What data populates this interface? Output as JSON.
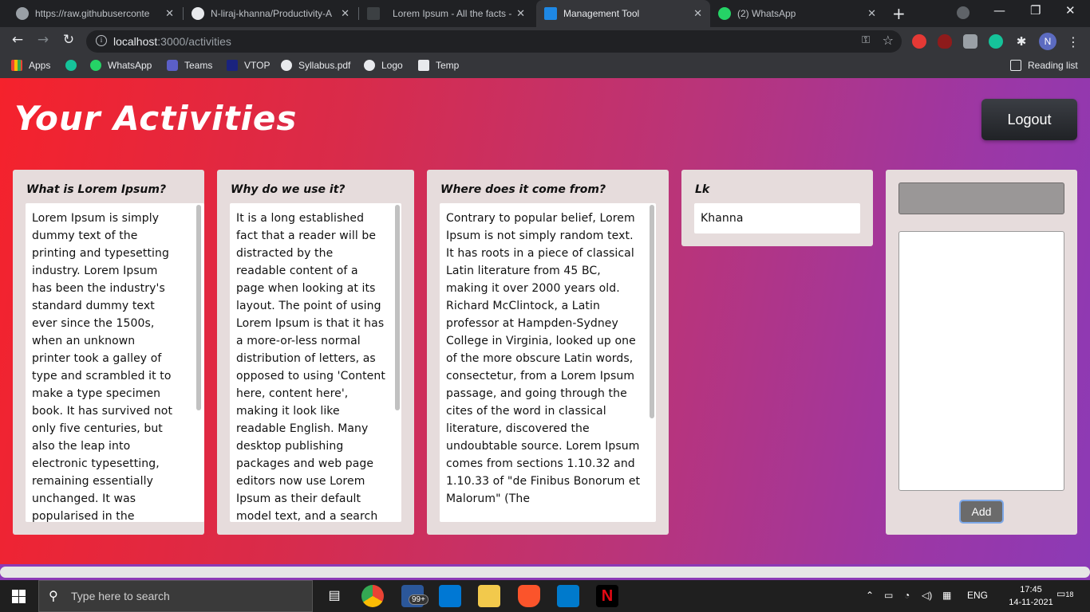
{
  "browser": {
    "tabs": [
      {
        "title": "https://raw.githubuserconte",
        "favicon": "globe-icon"
      },
      {
        "title": "N-liraj-khanna/Productivity-A",
        "favicon": "github-icon"
      },
      {
        "title": "Lorem Ipsum - All the facts - L",
        "favicon": "document-icon"
      },
      {
        "title": "Management Tool",
        "favicon": "management-tool-icon"
      },
      {
        "title": "(2) WhatsApp",
        "favicon": "whatsapp-icon"
      }
    ],
    "active_tab_index": 3,
    "url_host": "localhost",
    "url_rest": ":3000/activities",
    "bookmarks": [
      "Apps",
      "WhatsApp",
      "Teams",
      "VTOP",
      "Syllabus.pdf",
      "Logo",
      "Temp"
    ],
    "reading_list": "Reading list",
    "profile_initial": "N"
  },
  "page": {
    "title": "Your Activities",
    "logout_label": "Logout",
    "activities": [
      {
        "title": "What is Lorem Ipsum?",
        "text": "Lorem Ipsum is simply dummy text of the printing and typesetting industry. Lorem Ipsum has been the industry's standard dummy text ever since the 1500s, when an unknown printer took a galley of type and scrambled it to make a type specimen book. It has survived not only five centuries, but also the leap into electronic typesetting, remaining essentially unchanged. It was popularised in the"
      },
      {
        "title": "Why do we use it?",
        "text": "It is a long established fact that a reader will be distracted by the readable content of a page when looking at its layout. The point of using Lorem Ipsum is that it has a more-or-less normal distribution of letters, as opposed to using 'Content here, content here', making it look like readable English. Many desktop publishing packages and web page editors now use Lorem Ipsum as their default model text, and a search"
      },
      {
        "title": "Where does it come from?",
        "text": "Contrary to popular belief, Lorem Ipsum is not simply random text. It has roots in a piece of classical Latin literature from 45 BC, making it over 2000 years old. Richard McClintock, a Latin professor at Hampden-Sydney College in Virginia, looked up one of the more obscure Latin words, consectetur, from a Lorem Ipsum passage, and going through the cites of the word in classical literature, discovered the undoubtable source. Lorem Ipsum comes from sections 1.10.32 and 1.10.33 of \"de Finibus Bonorum et Malorum\" (The"
      },
      {
        "title": "Lk",
        "text": "Khanna"
      }
    ],
    "new_activity": {
      "title_value": "",
      "description_value": "",
      "add_label": "Add"
    }
  },
  "taskbar": {
    "search_placeholder": "Type here to search",
    "mail_badge": "99+",
    "language": "ENG",
    "time": "17:45",
    "date": "14-11-2021",
    "notification_count": "18"
  }
}
